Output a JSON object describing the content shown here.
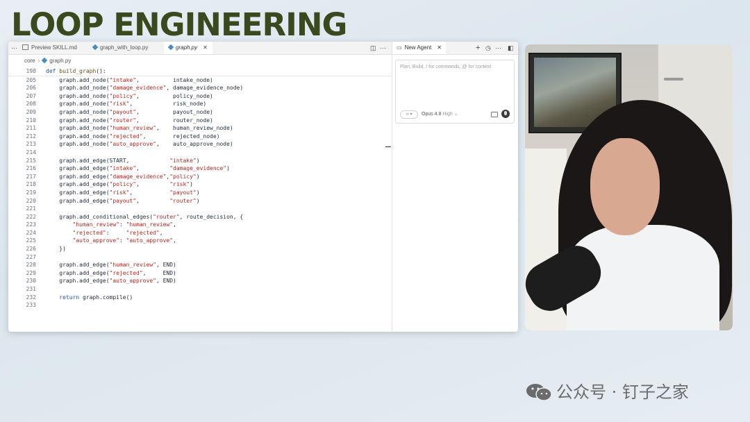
{
  "slide_title": "LOOP ENGINEERING",
  "editor": {
    "tabs": [
      {
        "label": "Preview SKILL.md",
        "active": false
      },
      {
        "label": "graph_with_loop.py",
        "active": false
      },
      {
        "label": "graph.py",
        "active": true
      }
    ],
    "tab_close": "✕",
    "breadcrumb": {
      "folder": "core",
      "file": "graph.py"
    },
    "sticky_line": {
      "number": "198",
      "keyword": "def",
      "name": "build_graph",
      "rest": "():"
    },
    "lines": [
      {
        "n": "205",
        "code": "    graph.add_node(\"intake\",          intake_node)"
      },
      {
        "n": "206",
        "code": "    graph.add_node(\"damage_evidence\", damage_evidence_node)"
      },
      {
        "n": "207",
        "code": "    graph.add_node(\"policy\",          policy_node)"
      },
      {
        "n": "208",
        "code": "    graph.add_node(\"risk\",            risk_node)"
      },
      {
        "n": "209",
        "code": "    graph.add_node(\"payout\",          payout_node)"
      },
      {
        "n": "210",
        "code": "    graph.add_node(\"router\",          router_node)"
      },
      {
        "n": "211",
        "code": "    graph.add_node(\"human_review\",    human_review_node)"
      },
      {
        "n": "212",
        "code": "    graph.add_node(\"rejected\",        rejected_node)"
      },
      {
        "n": "213",
        "code": "    graph.add_node(\"auto_approve\",    auto_approve_node)"
      },
      {
        "n": "214",
        "code": ""
      },
      {
        "n": "215",
        "code": "    graph.add_edge(START,            \"intake\")"
      },
      {
        "n": "216",
        "code": "    graph.add_edge(\"intake\",         \"damage_evidence\")"
      },
      {
        "n": "217",
        "code": "    graph.add_edge(\"damage_evidence\",\"policy\")"
      },
      {
        "n": "218",
        "code": "    graph.add_edge(\"policy\",         \"risk\")"
      },
      {
        "n": "219",
        "code": "    graph.add_edge(\"risk\",           \"payout\")"
      },
      {
        "n": "220",
        "code": "    graph.add_edge(\"payout\",         \"router\")"
      },
      {
        "n": "221",
        "code": ""
      },
      {
        "n": "222",
        "code": "    graph.add_conditional_edges(\"router\", route_decision, {"
      },
      {
        "n": "223",
        "code": "        \"human_review\": \"human_review\","
      },
      {
        "n": "224",
        "code": "        \"rejected\":     \"rejected\","
      },
      {
        "n": "225",
        "code": "        \"auto_approve\": \"auto_approve\","
      },
      {
        "n": "226",
        "code": "    })"
      },
      {
        "n": "227",
        "code": ""
      },
      {
        "n": "228",
        "code": "    graph.add_edge(\"human_review\", END)"
      },
      {
        "n": "229",
        "code": "    graph.add_edge(\"rejected\",     END)"
      },
      {
        "n": "230",
        "code": "    graph.add_edge(\"auto_approve\", END)"
      },
      {
        "n": "231",
        "code": ""
      },
      {
        "n": "232",
        "code": "    return graph.compile()"
      },
      {
        "n": "233",
        "code": ""
      }
    ]
  },
  "agent": {
    "tab_label": "New Agent",
    "tab_close": "✕",
    "placeholder": "Plan, Build, / for commands, @ for context",
    "mode_toggle": "∞",
    "model": "Opus 4.8",
    "effort": "High"
  },
  "icons": [
    "file-icon",
    "python-diamond-icon",
    "split-editor-icon",
    "more-icon",
    "chat-icon",
    "plus-icon",
    "history-icon",
    "panel-icon",
    "image-icon",
    "microphone-icon",
    "wechat-logo-icon"
  ],
  "watermark": {
    "text": "公众号 · 钉子之家"
  },
  "colors": {
    "title": "#3b4a1e",
    "keyword": "#1f4fb8",
    "string": "#b3261e"
  }
}
